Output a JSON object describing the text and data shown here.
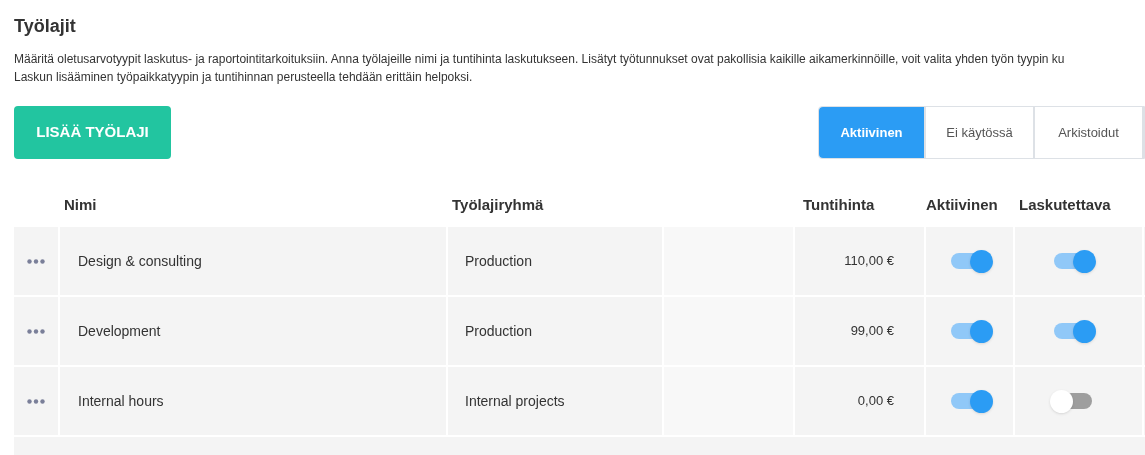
{
  "title": "Työlajit",
  "description": [
    "Määritä oletusarvotyypit laskutus- ja raportointitarkoituksiin. Anna työlajeille nimi ja tuntihinta laskutukseen. Lisätyt työtunnukset ovat pakollisia kaikille aikamerkinnöille, voit valita yhden työn tyypin ku",
    "Laskun lisääminen työpaikkatyypin ja tuntihinnan perusteella tehdään erittäin helpoksi."
  ],
  "add_button": "LISÄÄ TYÖLAJI",
  "tabs": [
    {
      "label": "Aktiivinen",
      "selected": true
    },
    {
      "label": "Ei käytössä",
      "selected": false
    },
    {
      "label": "Arkistoidut",
      "selected": false
    }
  ],
  "table": {
    "columns": [
      "Nimi",
      "Työlajiryhmä",
      "Tuntihinta",
      "Aktiivinen",
      "Laskutettava"
    ],
    "rows": [
      {
        "name": "Design & consulting",
        "group": "Production",
        "price": "110,00 €",
        "active": true,
        "billable": true
      },
      {
        "name": "Development",
        "group": "Production",
        "price": "99,00 €",
        "active": true,
        "billable": true
      },
      {
        "name": "Internal hours",
        "group": "Internal projects",
        "price": "0,00 €",
        "active": true,
        "billable": false
      }
    ]
  }
}
